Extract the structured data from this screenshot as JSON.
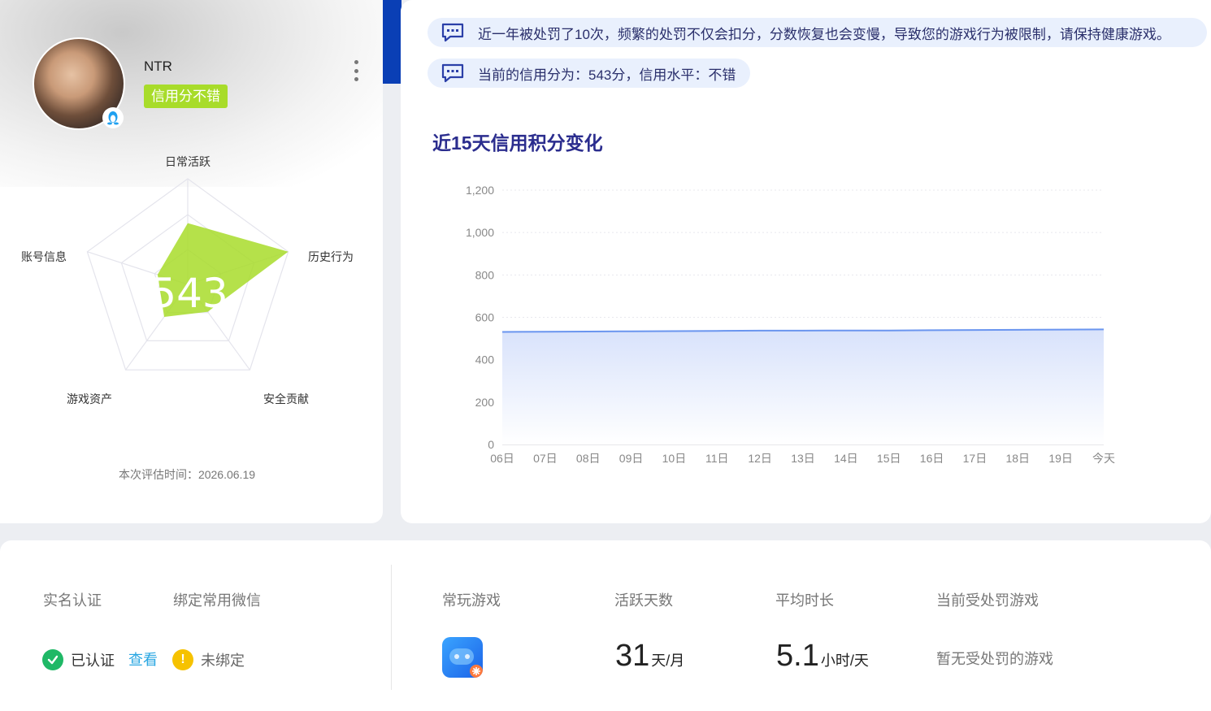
{
  "profile": {
    "username": "NTR",
    "credit_badge": "信用分不错",
    "score": "543",
    "eval_time": "本次评估时间：2026.06.19",
    "radar_labels": [
      "日常活跃",
      "历史行为",
      "安全贡献",
      "游戏资产",
      "账号信息"
    ],
    "radar_values": [
      0.58,
      1.0,
      0.32,
      0.38,
      0.3
    ]
  },
  "notices": {
    "punish": "近一年被处罚了10次，频繁的处罚不仅会扣分，分数恢复也会变慢，导致您的游戏行为被限制，请保持健康游戏。",
    "current": "当前的信用分为：543分，信用水平：不错"
  },
  "chart_title": "近15天信用积分变化",
  "chart_data": {
    "type": "area",
    "categories": [
      "06日",
      "07日",
      "08日",
      "09日",
      "10日",
      "11日",
      "12日",
      "13日",
      "14日",
      "15日",
      "16日",
      "17日",
      "18日",
      "19日",
      "今天"
    ],
    "values": [
      531,
      532,
      533,
      534,
      535,
      536,
      537,
      537,
      538,
      538,
      539,
      540,
      541,
      542,
      543
    ],
    "yticks": [
      "0",
      "200",
      "400",
      "600",
      "800",
      "1,000",
      "1,200"
    ],
    "ylim": [
      0,
      1200
    ],
    "grid": true,
    "color": "#6a95ef"
  },
  "bottom": {
    "realname_label": "实名认证",
    "wechat_label": "绑定常用微信",
    "verified_text": "已认证",
    "view_link": "查看",
    "unbound_text": "未绑定",
    "freq_game_label": "常玩游戏",
    "active_days_label": "活跃天数",
    "avg_time_label": "平均时长",
    "penalty_game_label": "当前受处罚游戏",
    "active_days": "31",
    "active_days_unit": "天/月",
    "avg_time": "5.1",
    "avg_time_unit": "小时/天",
    "penalty_none": "暂无受处罚的游戏"
  },
  "colors": {
    "accent_blue": "#0a3fb5",
    "badge_green": "#a8dc2a",
    "ok_green": "#1fb866",
    "warn_yellow": "#f6c200",
    "link_blue": "#2aa7e2"
  }
}
